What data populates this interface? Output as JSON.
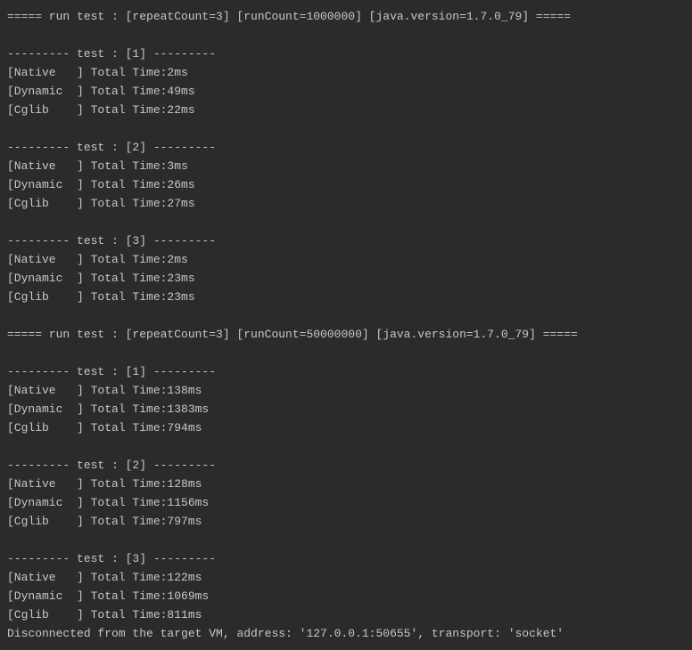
{
  "runs": [
    {
      "header": "===== run test : [repeatCount=3] [runCount=1000000] [java.version=1.7.0_79] =====",
      "blank_before": false,
      "tests": [
        {
          "divider": "--------- test : [1] ---------",
          "lines": [
            "[Native   ] Total Time:2ms",
            "[Dynamic  ] Total Time:49ms",
            "[Cglib    ] Total Time:22ms"
          ]
        },
        {
          "divider": "--------- test : [2] ---------",
          "lines": [
            "[Native   ] Total Time:3ms",
            "[Dynamic  ] Total Time:26ms",
            "[Cglib    ] Total Time:27ms"
          ]
        },
        {
          "divider": "--------- test : [3] ---------",
          "lines": [
            "[Native   ] Total Time:2ms",
            "[Dynamic  ] Total Time:23ms",
            "[Cglib    ] Total Time:23ms"
          ]
        }
      ]
    },
    {
      "header": "===== run test : [repeatCount=3] [runCount=50000000] [java.version=1.7.0_79] =====",
      "blank_before": true,
      "tests": [
        {
          "divider": "--------- test : [1] ---------",
          "lines": [
            "[Native   ] Total Time:138ms",
            "[Dynamic  ] Total Time:1383ms",
            "[Cglib    ] Total Time:794ms"
          ]
        },
        {
          "divider": "--------- test : [2] ---------",
          "lines": [
            "[Native   ] Total Time:128ms",
            "[Dynamic  ] Total Time:1156ms",
            "[Cglib    ] Total Time:797ms"
          ]
        },
        {
          "divider": "--------- test : [3] ---------",
          "lines": [
            "[Native   ] Total Time:122ms",
            "[Dynamic  ] Total Time:1069ms",
            "[Cglib    ] Total Time:811ms"
          ]
        }
      ]
    }
  ],
  "footer": "Disconnected from the target VM, address: '127.0.0.1:50655', transport: 'socket'"
}
